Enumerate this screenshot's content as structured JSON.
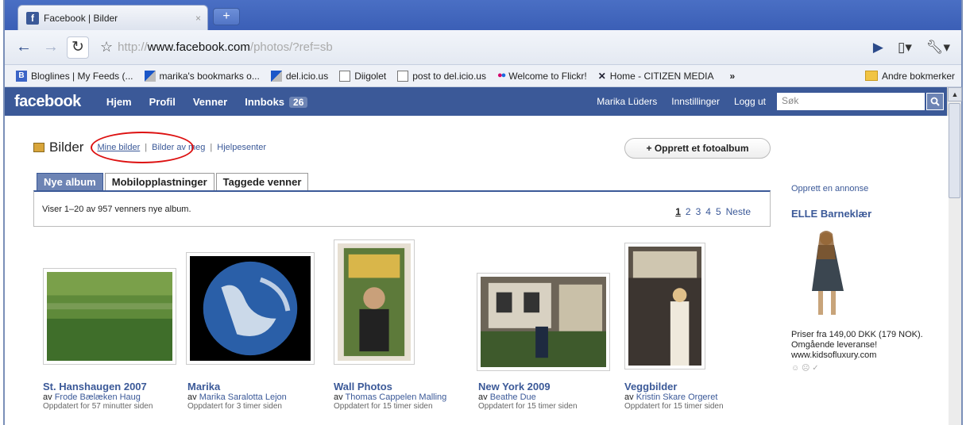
{
  "browser": {
    "tab_title": "Facebook | Bilder",
    "tab_close": "×",
    "new_tab": "+",
    "url_prefix": "http://",
    "url_host": "www.facebook.com",
    "url_path": "/photos/?ref=sb",
    "bookmarks": [
      {
        "label": "Bloglines | My Feeds (...",
        "icon": "bloglines-icon"
      },
      {
        "label": "marika's bookmarks o...",
        "icon": "delicious-icon"
      },
      {
        "label": "del.icio.us",
        "icon": "delicious-icon"
      },
      {
        "label": "Diigolet",
        "icon": "page-icon"
      },
      {
        "label": "post to del.icio.us",
        "icon": "page-icon"
      },
      {
        "label": "Welcome to Flickr!",
        "icon": "flickr-icon"
      },
      {
        "label": "Home - CITIZEN MEDIA",
        "icon": "citizen-icon"
      }
    ],
    "bookmarks_more": "»",
    "other_bookmarks": "Andre bokmerker"
  },
  "fb": {
    "logo": "facebook",
    "nav": [
      "Hjem",
      "Profil",
      "Venner",
      "Innboks"
    ],
    "inbox_count": "26",
    "user": "Marika Lüders",
    "settings": "Innstillinger",
    "logout": "Logg ut",
    "search_placeholder": "Søk"
  },
  "page": {
    "title": "Bilder",
    "links": [
      "Mine bilder",
      "Bilder av meg",
      "Hjelpesenter"
    ],
    "create_album": "+ Opprett et fotoalbum",
    "tabs": [
      "Nye album",
      "Mobilopplastninger",
      "Taggede venner"
    ],
    "list_text": "Viser 1–20 av 957 venners nye album.",
    "pager": [
      "1",
      "2",
      "3",
      "4",
      "5",
      "Neste"
    ]
  },
  "albums": [
    {
      "title": "St. Hanshaugen 2007",
      "by_prefix": "av",
      "owner": "Frode Bælæken Haug",
      "updated": "Oppdatert for 57 minutter siden"
    },
    {
      "title": "Marika",
      "by_prefix": "av",
      "owner": "Marika Saralotta Lejon",
      "updated": "Oppdatert for 3 timer siden"
    },
    {
      "title": "Wall Photos",
      "by_prefix": "av",
      "owner": "Thomas Cappelen Malling",
      "updated": "Oppdatert for 15 timer siden"
    },
    {
      "title": "New York 2009",
      "by_prefix": "av",
      "owner": "Beathe Due",
      "updated": "Oppdatert for 15 timer siden"
    },
    {
      "title": "Veggbilder",
      "by_prefix": "av",
      "owner": "Kristin Skare Orgeret",
      "updated": "Oppdatert for 15 timer siden"
    }
  ],
  "ad": {
    "create": "Opprett en annonse",
    "title": "ELLE Barneklær",
    "text": "Priser fra 149,00 DKK (179 NOK). Omgående leveranse! www.kidsofluxury.com",
    "like": "☺ ☹ ✓"
  }
}
